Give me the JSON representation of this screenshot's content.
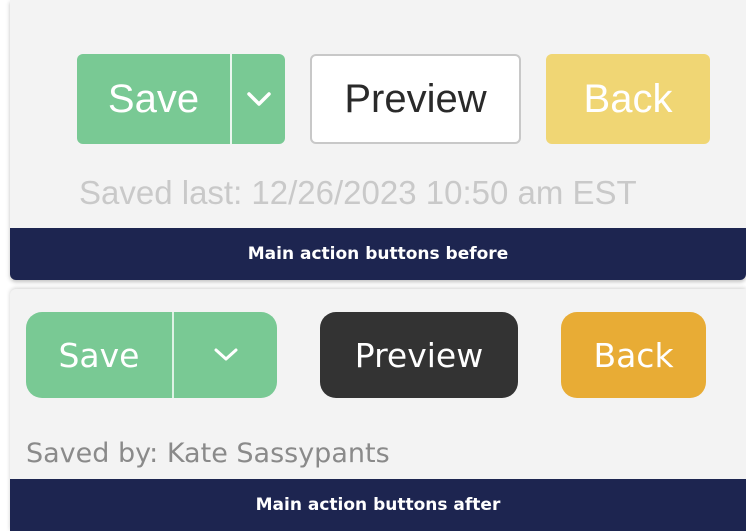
{
  "before": {
    "save_label": "Save",
    "preview_label": "Preview",
    "back_label": "Back",
    "saved_text": "Saved last: 12/26/2023 10:50 am EST",
    "caption": "Main action buttons before",
    "icons": {
      "dropdown": "chevron-down-icon"
    },
    "colors": {
      "save": "#79c994",
      "preview_bg": "#ffffff",
      "preview_border": "#c8c8c8",
      "back": "#f0d674",
      "caption_bar": "#1d2550"
    }
  },
  "after": {
    "save_label": "Save",
    "preview_label": "Preview",
    "back_label": "Back",
    "saved_text": "Saved by: Kate Sassypants",
    "caption": "Main action buttons after",
    "icons": {
      "dropdown": "chevron-down-icon"
    },
    "colors": {
      "save": "#79c994",
      "preview_bg": "#333333",
      "back": "#e8ac35",
      "caption_bar": "#1d2550"
    }
  }
}
